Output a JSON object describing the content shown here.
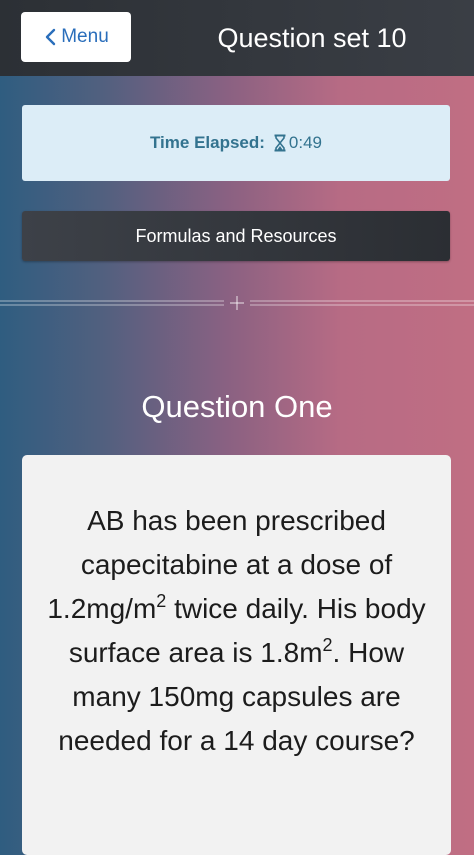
{
  "header": {
    "menu_label": "Menu",
    "title": "Question set 10"
  },
  "timer": {
    "label": "Time Elapsed:",
    "icon": "hourglass-icon",
    "value": "0:49"
  },
  "resources": {
    "button_label": "Formulas and Resources"
  },
  "question": {
    "heading": "Question One",
    "text_part1": "AB has been prescribed capecitabine at a dose of 1.2mg/m",
    "sup1": "2",
    "text_part2": " twice daily. His body surface area is 1.8m",
    "sup2": "2",
    "text_part3": ". How many 150mg capsules are needed for a 14 day course?"
  },
  "colors": {
    "menu_text": "#2a6ebb",
    "timer_bg": "#dcedf7",
    "timer_text": "#33738f",
    "topbar_bg": "#2c3035",
    "card_bg": "#f2f2f2"
  }
}
